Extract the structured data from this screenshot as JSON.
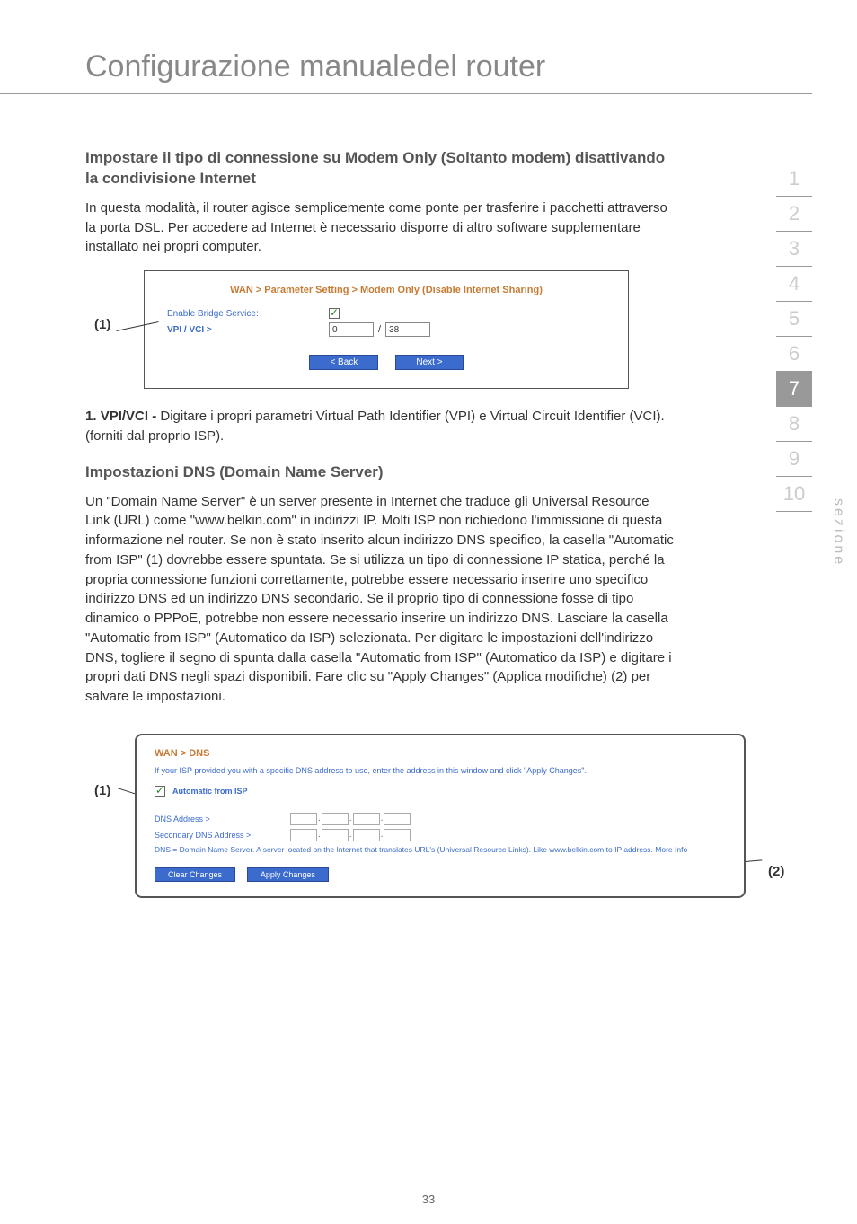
{
  "page_title": "Configurazione manualedel router",
  "section1": {
    "heading": "Impostare il tipo di connessione su Modem Only (Soltanto modem) disattivando la condivisione Internet",
    "body": "In questa modalità, il router agisce semplicemente come ponte per trasferire i pacchetti attraverso la porta DSL. Per accedere ad Internet è necessario disporre di altro software supplementare installato nei propri computer."
  },
  "callout1": "(1)",
  "screenshot1": {
    "breadcrumb": "WAN > Parameter Setting > Modem Only (Disable Internet Sharing)",
    "enable_label": "Enable Bridge Service:",
    "vpi_label": "VPI / VCI >",
    "vpi_value": "0",
    "vci_value": "38",
    "back_btn": "< Back",
    "next_btn": "Next >"
  },
  "list1": {
    "num": "1.",
    "title": "VPI/VCI -",
    "text": "Digitare i propri parametri Virtual Path Identifier (VPI) e Virtual Circuit Identifier (VCI). (forniti dal proprio ISP)."
  },
  "section2": {
    "heading": "Impostazioni DNS (Domain Name Server)",
    "body": "Un \"Domain Name Server\" è un server presente in Internet che traduce gli Universal Resource Link (URL) come \"www.belkin.com\" in indirizzi IP. Molti ISP non richiedono l'immissione di questa informazione nel router. Se non è stato inserito alcun indirizzo DNS specifico, la casella \"Automatic from ISP\" (1) dovrebbe essere spuntata. Se si utilizza un tipo di connessione IP statica, perché la propria connessione funzioni correttamente, potrebbe essere necessario inserire uno specifico indirizzo DNS ed un indirizzo DNS secondario. Se il proprio tipo di connessione fosse di tipo dinamico o PPPoE, potrebbe non essere necessario inserire un indirizzo DNS. Lasciare la casella \"Automatic from ISP\" (Automatico da ISP) selezionata. Per digitare le impostazioni dell'indirizzo DNS, togliere il segno di spunta dalla casella \"Automatic from ISP\" (Automatico da ISP) e digitare i propri dati DNS negli spazi disponibili. Fare clic su \"Apply Changes\" (Applica modifiche) (2) per salvare le impostazioni."
  },
  "callout2_left": "(1)",
  "callout2_right": "(2)",
  "screenshot2": {
    "breadcrumb": "WAN > DNS",
    "desc": "If your ISP provided you with a specific DNS address to use, enter the address in this window and click \"Apply Changes\".",
    "auto_label": "Automatic from ISP",
    "dns_label": "DNS Address >",
    "sec_dns_label": "Secondary DNS Address >",
    "note": "DNS = Domain Name Server. A server located on the Internet that translates URL's (Universal Resource Links). Like www.belkin.com to IP address. More Info",
    "clear_btn": "Clear Changes",
    "apply_btn": "Apply Changes"
  },
  "sidenav": [
    "1",
    "2",
    "3",
    "4",
    "5",
    "6",
    "7",
    "8",
    "9",
    "10"
  ],
  "sidenav_active_index": 6,
  "side_label": "sezione",
  "page_number": "33"
}
